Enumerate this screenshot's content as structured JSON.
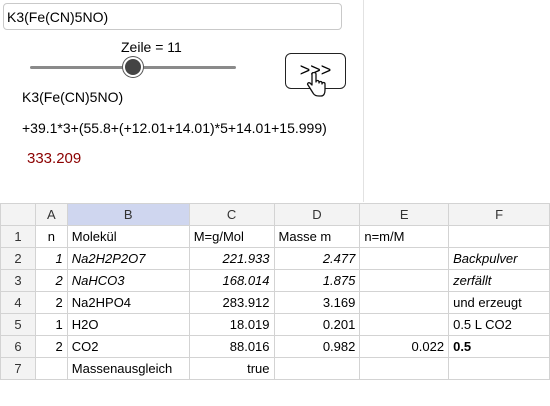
{
  "input": {
    "value": "K3(Fe(CN)5NO)"
  },
  "slider": {
    "label": "Zeile = 11",
    "position_fraction": 0.47
  },
  "next_button": {
    "label": ">>>"
  },
  "formula_text": "K3(Fe(CN)5NO)",
  "expression_text": "+39.1*3+(55.8+(+12.01+14.01)*5+14.01+15.999)",
  "result_text": "333.209",
  "colors": {
    "result": "#8b0000",
    "selected_header": "#cfd6ef"
  },
  "spreadsheet": {
    "column_headers": [
      "A",
      "B",
      "C",
      "D",
      "E",
      "F"
    ],
    "selected_column": "B",
    "rows": [
      {
        "num": "1",
        "cells": [
          "n",
          "Molekül",
          "M=g/Mol",
          "Masse m",
          "n=m/M",
          ""
        ]
      },
      {
        "num": "2",
        "cells": [
          "1",
          "Na2H2P2O7",
          "221.933",
          "2.477",
          "",
          "Backpulver"
        ]
      },
      {
        "num": "3",
        "cells": [
          "2",
          "NaHCO3",
          "168.014",
          "1.875",
          "",
          "zerfällt"
        ]
      },
      {
        "num": "4",
        "cells": [
          "2",
          "Na2HPO4",
          "283.912",
          "3.169",
          "",
          "und erzeugt"
        ]
      },
      {
        "num": "5",
        "cells": [
          "1",
          "H2O",
          "18.019",
          "0.201",
          "",
          "0.5 L CO2"
        ]
      },
      {
        "num": "6",
        "cells": [
          "2",
          "CO2",
          "88.016",
          "0.982",
          "0.022",
          "0.5"
        ]
      },
      {
        "num": "7",
        "cells": [
          "",
          "Massenausgleich",
          "true",
          "",
          "",
          ""
        ]
      }
    ]
  }
}
